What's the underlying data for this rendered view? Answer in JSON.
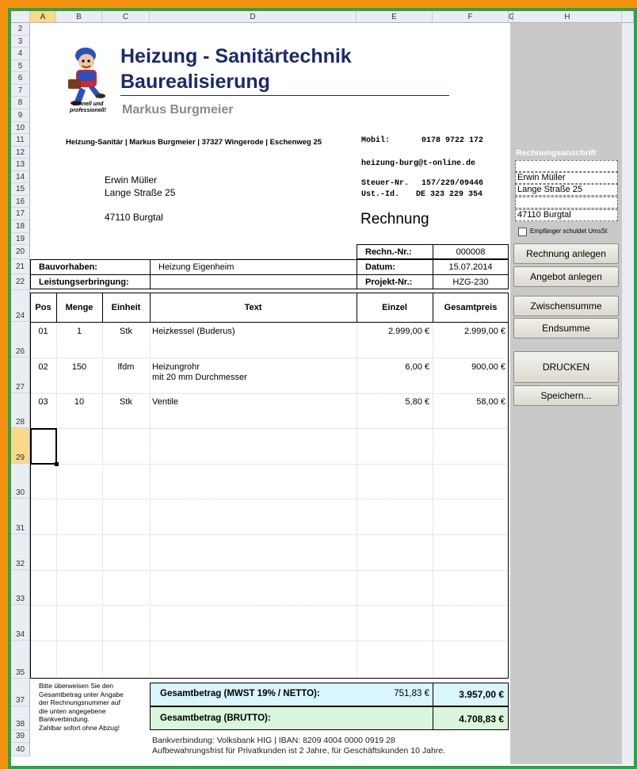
{
  "columns": [
    "A",
    "B",
    "C",
    "D",
    "E",
    "F",
    "G",
    "H"
  ],
  "rows": [
    "2",
    "3",
    "4",
    "5",
    "6",
    "7",
    "8",
    "9",
    "10",
    "11",
    "12",
    "13",
    "14",
    "15",
    "16",
    "17",
    "18",
    "19",
    "20",
    "21",
    "22",
    "24",
    "26",
    "27",
    "28",
    "29",
    "30",
    "31",
    "32",
    "33",
    "34",
    "35",
    "37",
    "38",
    "39",
    "40"
  ],
  "company": {
    "line1": "Heizung - Sanitärtechnik",
    "line2": "Baurealisierung",
    "owner": "Markus Burgmeier",
    "slogan": "schnell und professionell!"
  },
  "sender_line": "Heizung-Sanitär | Markus Burgmeier | 37327 Wingerode | Eschenweg 25",
  "contact": {
    "mobil_label": "Mobil:",
    "mobil": "0178 9722 172",
    "email": "heizung-burg@t-online.de",
    "steuer_label": "Steuer-Nr.",
    "steuer": "157/229/09446",
    "ust_label": "Ust.-Id.",
    "ust": "DE 323 229 354"
  },
  "recipient": {
    "name": "Erwin Müller",
    "street": "Lange Straße 25",
    "city": "47110 Burgtal"
  },
  "doc_title": "Rechnung",
  "meta": {
    "rechn_label": "Rechn.-Nr.:",
    "rechn": "000008",
    "datum_label": "Datum:",
    "datum": "15.07.2014",
    "projekt_label": "Projekt-Nr.:",
    "projekt": "HZG-230",
    "bauvorhaben_label": "Bauvorhaben:",
    "bauvorhaben": "Heizung Eigenheim",
    "leistung_label": "Leistungserbringung:",
    "leistung": ""
  },
  "table": {
    "headers": [
      "Pos",
      "Menge",
      "Einheit",
      "Text",
      "Einzel",
      "Gesamtpreis"
    ],
    "rows": [
      {
        "pos": "01",
        "menge": "1",
        "einheit": "Stk",
        "text1": "Heizkessel (Buderus)",
        "text2": "",
        "einzel": "2.999,00 €",
        "gesamt": "2.999,00 €"
      },
      {
        "pos": "02",
        "menge": "150",
        "einheit": "lfdm",
        "text1": "Heizungrohr",
        "text2": "mit 20 mm Durchmesser",
        "einzel": "6,00 €",
        "gesamt": "900,00 €"
      },
      {
        "pos": "03",
        "menge": "10",
        "einheit": "Stk",
        "text1": "Ventile",
        "text2": "",
        "einzel": "5,80 €",
        "gesamt": "58,00 €"
      }
    ]
  },
  "payment_note": [
    "Bitte überweisen Sie den",
    "Gesamtbetrag unter Angabe",
    "der Rechnungsnummer auf",
    "die unten angegebene",
    "Bankverbindung.",
    "Zahlbar sofort ohne Abzug!"
  ],
  "totals": {
    "netto_label": "Gesamtbetrag (MWST 19% / NETTO):",
    "mwst": "751,83 €",
    "netto": "3.957,00 €",
    "brutto_label": "Gesamtbetrag (BRUTTO):",
    "brutto": "4.708,83 €"
  },
  "footer": {
    "bank": "Bankverbindung: Volksbank HIG | IBAN: 8209 4004 0000 0919 28",
    "retention": "Aufbewahrungsfrist für Privatkunden ist 2 Jahre, für Geschäftskunden 10 Jahre."
  },
  "sidebar": {
    "title": "Rechnungsanschrift",
    "name": "Erwin Müller",
    "street": "Lange Straße 25",
    "empty": "",
    "city": "47110 Burgtal",
    "checkbox": "Empfänger schuldet UmsSt",
    "buttons": {
      "rechnung": "Rechnung anlegen",
      "angebot": "Angebot anlegen",
      "zwischensumme": "Zwischensumme",
      "endsumme": "Endsumme",
      "drucken": "DRUCKEN",
      "speichern": "Speichern..."
    }
  },
  "colors": {
    "accent_blue": "#1a2a6c",
    "netto_bg": "#d8f6fb",
    "brutto_bg": "#d9f5dc",
    "frame_orange": "#f39010",
    "frame_green": "#2fa14a"
  }
}
